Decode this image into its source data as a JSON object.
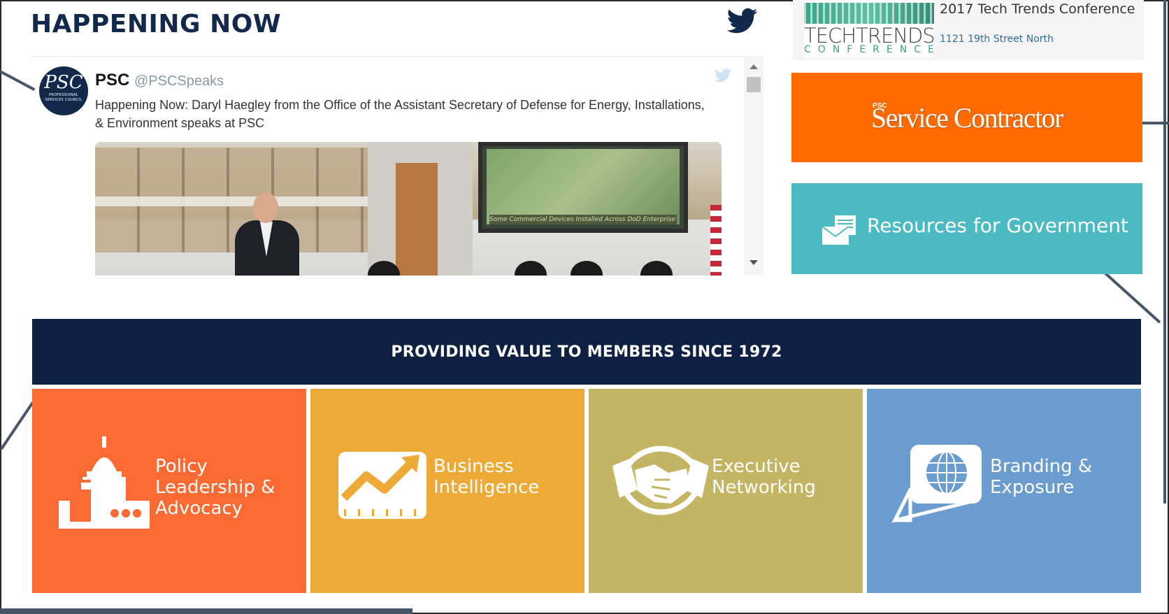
{
  "happening": {
    "title": "HAPPENING NOW"
  },
  "tweet": {
    "name": "PSC",
    "handle": "@PSCSpeaks",
    "text": "Happening Now: Daryl Haegley from the Office of the Assistant Secretary of Defense for Energy, Installations, & Environment speaks at PSC",
    "avatar_text": "PSC",
    "avatar_subtext": "PROFESSIONAL SERVICES COUNCIL",
    "photo_caption": "Some Commercial Devices Installed Across DoD Enterprise"
  },
  "event": {
    "title": "2017 Tech Trends Conference",
    "address": "1121 19th Street North",
    "logo_line1": "TECHTRENDS",
    "logo_line2": "CONFERENCE"
  },
  "buttons": {
    "service_contractor": "Service Contractor",
    "service_contractor_badge": "PSC",
    "resources_government": "Resources for Government"
  },
  "banner": {
    "text": "PROVIDING VALUE TO MEMBERS SINCE 1972"
  },
  "tiles": [
    {
      "label": "Policy Leadership & Advocacy",
      "icon": "capitol-icon",
      "color": "#fb6a33"
    },
    {
      "label": "Business Intelligence",
      "icon": "chart-icon",
      "color": "#eeaa36"
    },
    {
      "label": "Executive Networking",
      "icon": "handshake-icon",
      "color": "#c4b563"
    },
    {
      "label": "Branding & Exposure",
      "icon": "globe-icon",
      "color": "#6a9cd0"
    }
  ],
  "colors": {
    "navy": "#0e2142",
    "orange": "#ff6b00",
    "teal": "#4bbac2",
    "twitter": "#13294b"
  }
}
